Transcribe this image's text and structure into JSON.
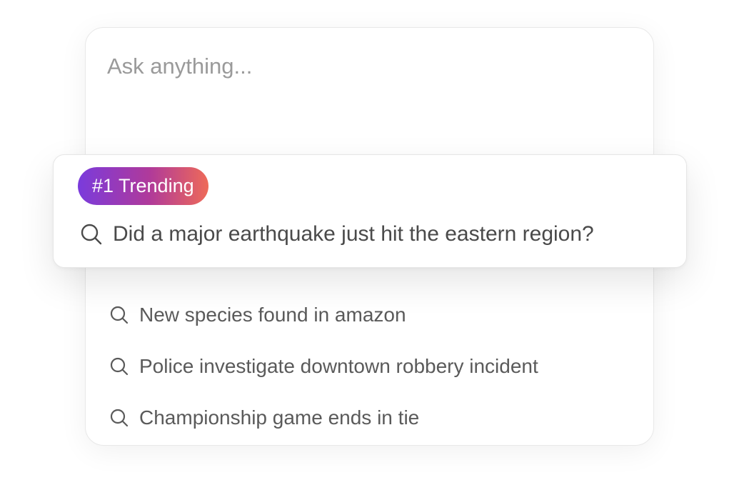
{
  "search": {
    "placeholder": "Ask anything..."
  },
  "trending": {
    "badge_label": "#1 Trending",
    "query": "Did a major earthquake just hit the eastern region?",
    "icon": "search-icon"
  },
  "suggestions": [
    {
      "text": "New species found in amazon",
      "icon": "search-icon"
    },
    {
      "text": "Police investigate downtown robbery incident",
      "icon": "search-icon"
    },
    {
      "text": "Championship game ends in tie",
      "icon": "search-icon"
    }
  ],
  "colors": {
    "badge_gradient_start": "#7a3bdc",
    "badge_gradient_mid": "#b03a9a",
    "badge_gradient_end": "#ee6a58",
    "text": "#5a5a5a",
    "placeholder": "#9a9a9a",
    "border": "#e8e8e8"
  }
}
